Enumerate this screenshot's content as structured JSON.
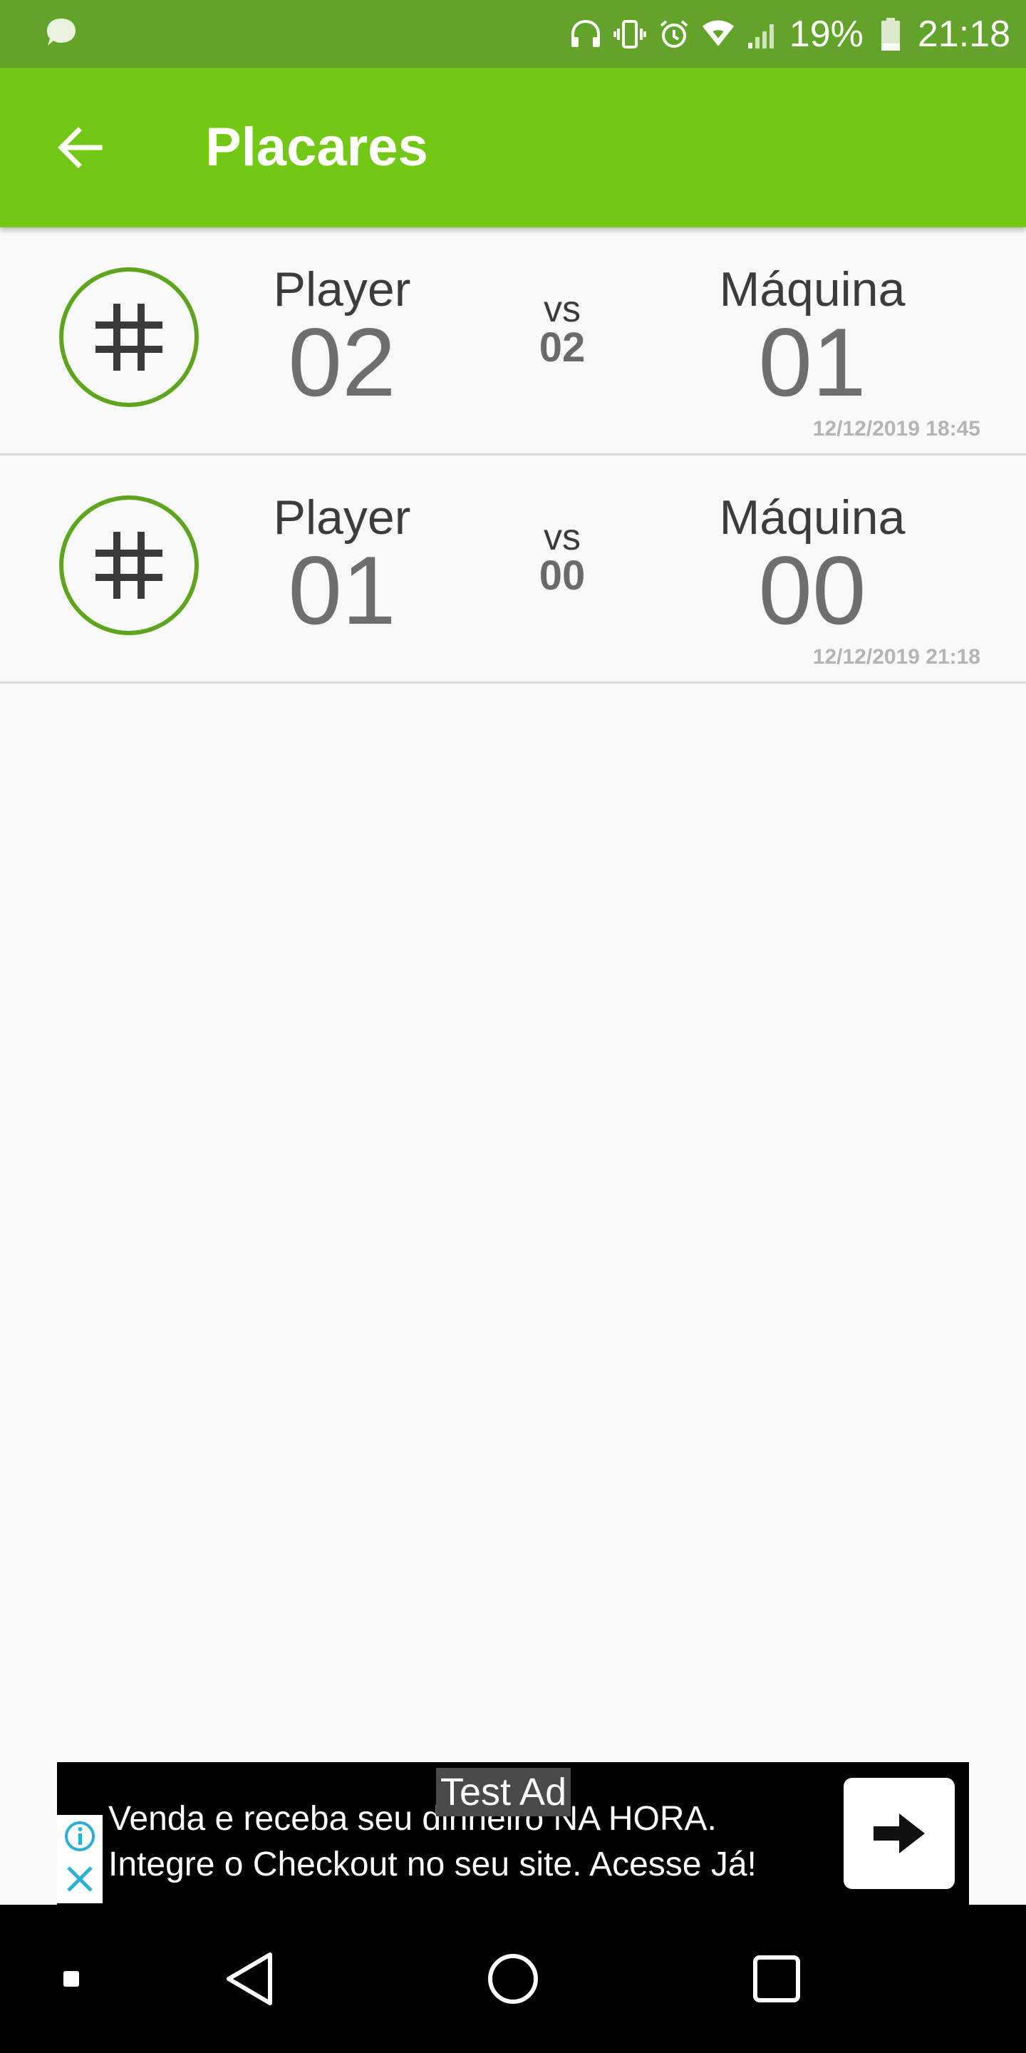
{
  "status_bar": {
    "battery_percent": "19%",
    "time": "21:18",
    "icons": [
      "chat-bubble-icon",
      "headset-icon",
      "vibrate-icon",
      "alarm-icon",
      "wifi-icon",
      "signal-icon",
      "battery-icon"
    ]
  },
  "app_bar": {
    "title": "Placares",
    "back_icon": "arrow-left-icon",
    "background": "#72c814"
  },
  "scores": [
    {
      "player_label": "Player",
      "player_score": "02",
      "vs_label": "vs",
      "draws": "02",
      "cpu_label": "Máquina",
      "cpu_score": "01",
      "date": "12/12/2019 18:45",
      "icon": "hash-grid-icon"
    },
    {
      "player_label": "Player",
      "player_score": "01",
      "vs_label": "vs",
      "draws": "00",
      "cpu_label": "Máquina",
      "cpu_score": "00",
      "date": "12/12/2019 21:18",
      "icon": "hash-grid-icon"
    }
  ],
  "ad": {
    "badge": "Test Ad",
    "line1": "Venda e receba seu dinheiro NA HORA.",
    "line2": "Integre o Checkout no seu site. Acesse Já!"
  },
  "nav_bar": {
    "items": [
      "square-dot-icon",
      "back-triangle-icon",
      "home-circle-icon",
      "recents-square-icon"
    ]
  }
}
